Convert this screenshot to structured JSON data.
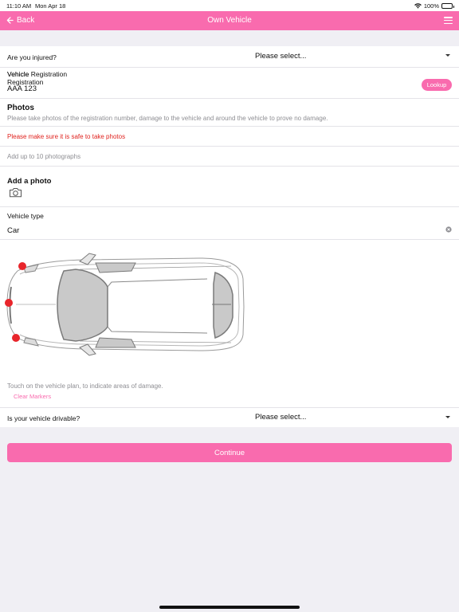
{
  "status_bar": {
    "time": "11:10 AM",
    "date": "Mon Apr 18",
    "battery": "100%"
  },
  "nav": {
    "back_label": "Back",
    "title": "Own Vehicle"
  },
  "injured": {
    "label": "Are you injured?",
    "value": "Please select..."
  },
  "registration": {
    "label": "Vehicle Registration",
    "value": "AAA 123",
    "lookup_label": "Lookup"
  },
  "photos": {
    "title": "Photos",
    "description": "Please take photos of the registration number, damage to the vehicle and around the vehicle to prove no damage.",
    "warning": "Please make sure it is safe to take photos",
    "limit_text": "Add up to 10 photographs",
    "add_title": "Add a photo"
  },
  "vehicle_type": {
    "label": "Vehicle type",
    "value": "Car"
  },
  "vehicle_plan": {
    "hint": "Touch on the vehicle plan, to indicate areas of damage.",
    "clear_label": "Clear Markers",
    "marker_color": "#e8252b",
    "marker_count": 3
  },
  "drivable": {
    "label": "Is your vehicle drivable?",
    "value": "Please select..."
  },
  "continue_label": "Continue",
  "colors": {
    "accent": "#f96bae",
    "warning": "#e0231f",
    "muted": "#8e8e93",
    "background": "#f0eff4"
  }
}
